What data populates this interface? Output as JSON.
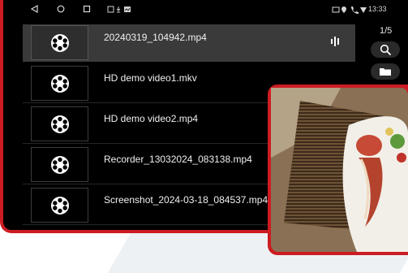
{
  "status_bar": {
    "time": "13:33"
  },
  "pager": {
    "text": "1/5"
  },
  "files": [
    {
      "name": "20240319_104942.mp4",
      "selected": true,
      "playing": true
    },
    {
      "name": "HD demo video1.mkv",
      "selected": false,
      "playing": false
    },
    {
      "name": "HD demo video2.mp4",
      "selected": false,
      "playing": false
    },
    {
      "name": "Recorder_13032024_083138.mp4",
      "selected": false,
      "playing": false
    },
    {
      "name": "Screenshot_2024-03-18_084537.mp4",
      "selected": false,
      "playing": false
    }
  ],
  "icons": {
    "thumbnail": "film-reel-icon",
    "playing": "equalizer-icon",
    "search": "search-icon",
    "folder": "folder-icon",
    "back": "back-triangle-icon",
    "home": "home-circle-icon",
    "recents": "recents-square-icon"
  },
  "colors": {
    "device_frame": "#cc1c22",
    "screen": "#000000",
    "selected_row": "#3a3a3a"
  }
}
